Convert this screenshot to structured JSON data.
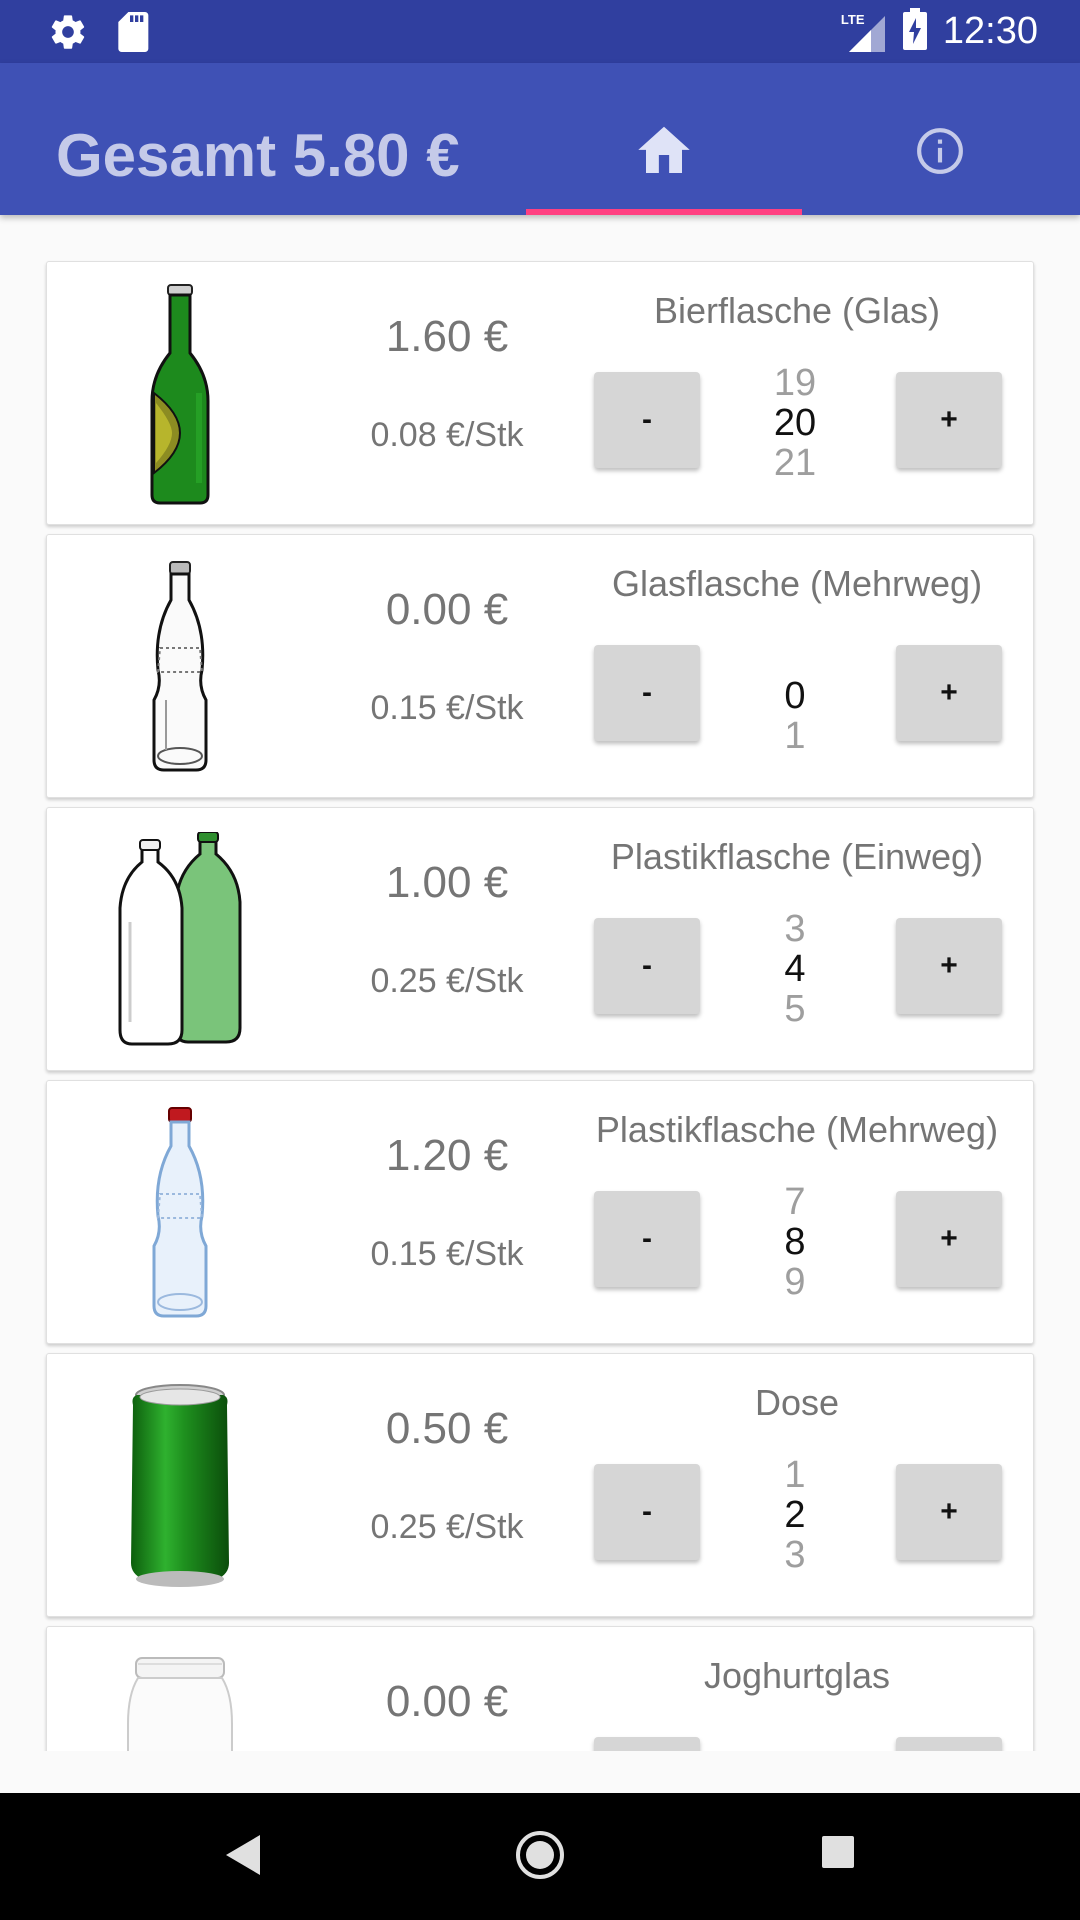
{
  "status_bar": {
    "time": "12:30",
    "network": "LTE",
    "icons": [
      "settings-icon",
      "sd-card-icon",
      "signal-icon",
      "battery-charging-icon"
    ]
  },
  "app_bar": {
    "title": "Gesamt 5.80 €",
    "tabs": [
      {
        "icon": "home-icon",
        "selected": true
      },
      {
        "icon": "info-icon",
        "selected": false
      }
    ],
    "colors": {
      "primary": "#3f51b5",
      "primary_dark": "#303f9f",
      "accent": "#ff4081"
    }
  },
  "items": [
    {
      "name": "Bierflasche (Glas)",
      "total": "1.60 €",
      "unit_price": "0.08 €/Stk",
      "prev": "19",
      "count": "20",
      "next": "21",
      "icon": "beer-bottle-icon",
      "minus": "-",
      "plus": "+"
    },
    {
      "name": "Glasflasche (Mehrweg)",
      "total": "0.00 €",
      "unit_price": "0.15 €/Stk",
      "prev": "",
      "count": "0",
      "next": "1",
      "icon": "glass-bottle-icon",
      "minus": "-",
      "plus": "+"
    },
    {
      "name": "Plastikflasche (Einweg)",
      "total": "1.00 €",
      "unit_price": "0.25 €/Stk",
      "prev": "3",
      "count": "4",
      "next": "5",
      "icon": "plastic-bottles-icon",
      "minus": "-",
      "plus": "+"
    },
    {
      "name": "Plastikflasche (Mehrweg)",
      "total": "1.20 €",
      "unit_price": "0.15 €/Stk",
      "prev": "7",
      "count": "8",
      "next": "9",
      "icon": "plastic-bottle-reusable-icon",
      "minus": "-",
      "plus": "+"
    },
    {
      "name": "Dose",
      "total": "0.50 €",
      "unit_price": "0.25 €/Stk",
      "prev": "1",
      "count": "2",
      "next": "3",
      "icon": "can-icon",
      "minus": "-",
      "plus": "+"
    },
    {
      "name": "Joghurtglas",
      "total": "0.00 €",
      "unit_price": "",
      "prev": "",
      "count": "",
      "next": "",
      "icon": "yogurt-jar-icon",
      "minus": "",
      "plus": ""
    }
  ],
  "nav_bar": {
    "icons": [
      "back-icon",
      "home-circle-icon",
      "recents-icon"
    ]
  }
}
